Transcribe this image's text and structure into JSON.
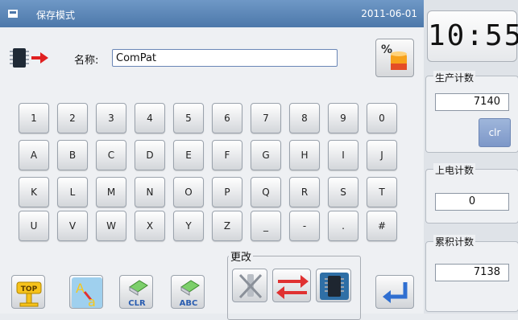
{
  "titlebar": {
    "title": "保存模式",
    "date": "2011-06-01"
  },
  "form": {
    "name_label": "名称:",
    "name_value": "ComPat"
  },
  "keyboard": {
    "rows": [
      [
        "1",
        "2",
        "3",
        "4",
        "5",
        "6",
        "7",
        "8",
        "9",
        "0"
      ],
      [
        "A",
        "B",
        "C",
        "D",
        "E",
        "F",
        "G",
        "H",
        "I",
        "J"
      ],
      [
        "K",
        "L",
        "M",
        "N",
        "O",
        "P",
        "Q",
        "R",
        "S",
        "T"
      ],
      [
        "U",
        "V",
        "W",
        "X",
        "Y",
        "Z",
        "_",
        "-",
        ".",
        "#"
      ]
    ]
  },
  "toolbar": {
    "top_label": "TOP",
    "clr_label": "CLR",
    "abc_label": "ABC",
    "change_group_label": "更改"
  },
  "side": {
    "clock": "10:55",
    "production_label": "生产计数",
    "production_value": "7140",
    "clr_button": "clr",
    "power_label": "上电计数",
    "power_value": "0",
    "cumulative_label": "累积计数",
    "cumulative_value": "7138"
  },
  "colors": {
    "titlebar": "#5a85b8",
    "accent_blue": "#2f6fd1",
    "red": "#e03131"
  }
}
